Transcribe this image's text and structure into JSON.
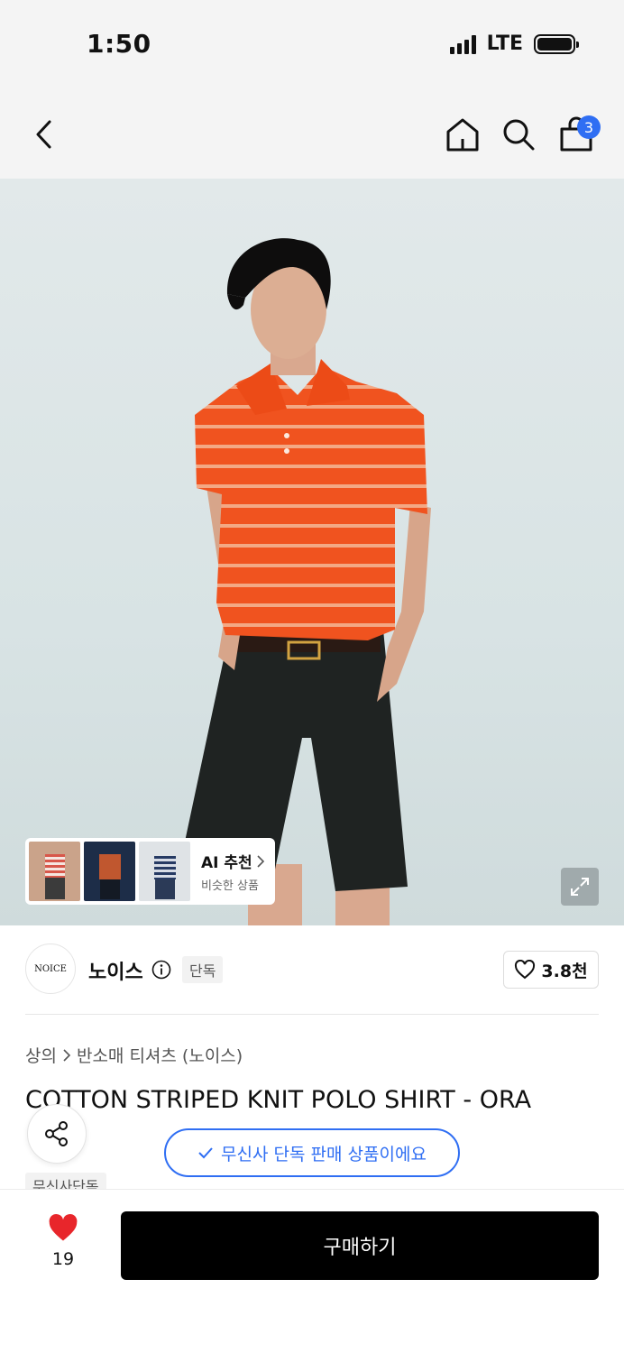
{
  "status_bar": {
    "time": "1:50",
    "network": "LTE"
  },
  "nav": {
    "cart_count": "3",
    "icons": [
      "back-icon",
      "home-icon",
      "search-icon",
      "shopping-bag-icon"
    ]
  },
  "ai_recommend": {
    "title": "AI 추천",
    "subtitle": "비슷한 상품"
  },
  "brand": {
    "logo_text": "NOICE",
    "name": "노이스",
    "exclusive_label": "단독",
    "like_count": "3.8천"
  },
  "breadcrumb": {
    "category": "상의",
    "subcategory": "반소매 티셔츠 (노이스)"
  },
  "product": {
    "title": "COTTON STRIPED KNIT POLO SHIRT - ORA"
  },
  "exclusive_banner": {
    "text": "무신사 단독 판매 상품이에요"
  },
  "tags": {
    "musinsa_exclusive": "무신사단독"
  },
  "bottom_bar": {
    "like_count": "19",
    "buy_label": "구매하기"
  },
  "colors": {
    "accent_blue": "#2f6ef3",
    "heart_red": "#e8262b",
    "shirt_orange": "#f0531f"
  }
}
